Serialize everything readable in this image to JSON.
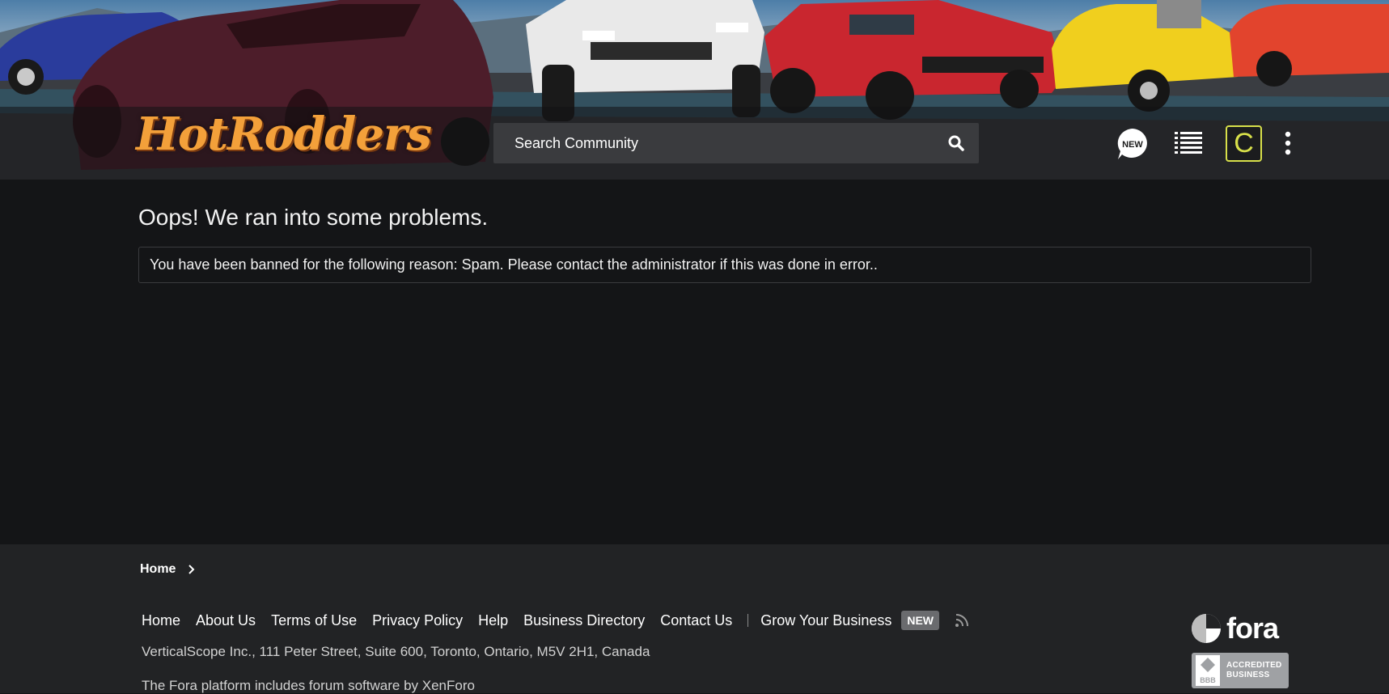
{
  "header": {
    "logo_main": "HotRodders",
    "search": {
      "placeholder": "Search Community"
    },
    "new_icon_text": "NEW",
    "avatar_letter": "C"
  },
  "main": {
    "title": "Oops! We ran into some problems.",
    "error_message": "You have been banned for the following reason: Spam. Please contact the administrator if this was done in error.."
  },
  "footer": {
    "breadcrumb": {
      "home": "Home"
    },
    "links": [
      "Home",
      "About Us",
      "Terms of Use",
      "Privacy Policy",
      "Help",
      "Business Directory",
      "Contact Us"
    ],
    "grow_business": "Grow Your Business",
    "new_badge": "NEW",
    "address": "VerticalScope Inc., 111 Peter Street, Suite 600, Toronto, Ontario, M5V 2H1, Canada",
    "platform_note": "The Fora platform includes forum software by XenForo",
    "fora_logo_text": "fora",
    "bbb_text_line1": "ACCREDITED",
    "bbb_text_line2": "BUSINESS",
    "bbb_mark_text": "BBB"
  },
  "colors": {
    "page_bg": "#141517",
    "footer_bg": "#222325",
    "avatar_accent": "#d8e04a",
    "logo_orange": "#f3a03a"
  },
  "icons": [
    "search-icon",
    "new-posts-icon",
    "list-icon",
    "more-icon",
    "chevron-right-icon",
    "rss-icon",
    "fora-logo-icon",
    "bbb-icon"
  ]
}
